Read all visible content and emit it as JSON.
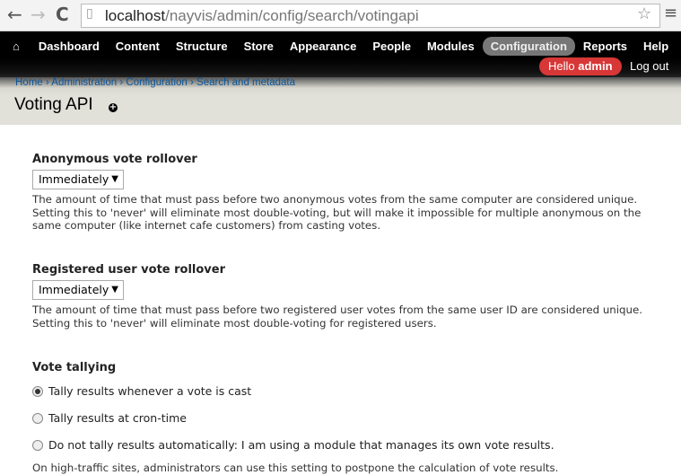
{
  "browser": {
    "url_host": "localhost",
    "url_path": "/nayvis/admin/config/search/votingapi"
  },
  "toolbar": {
    "items": [
      "Dashboard",
      "Content",
      "Structure",
      "Store",
      "Appearance",
      "People",
      "Modules",
      "Configuration",
      "Reports",
      "Help"
    ],
    "hello": "Hello",
    "user": "admin",
    "logout": "Log out"
  },
  "breadcrumb": [
    "Home",
    "Administration",
    "Configuration",
    "Search and metadata"
  ],
  "page_title": "Voting API",
  "anon": {
    "label": "Anonymous vote rollover",
    "value": "Immediately",
    "desc": "The amount of time that must pass before two anonymous votes from the same computer are considered unique. Setting this to 'never' will eliminate most double-voting, but will make it impossible for multiple anonymous on the same computer (like internet cafe customers) from casting votes."
  },
  "reg": {
    "label": "Registered user vote rollover",
    "value": "Immediately",
    "desc": "The amount of time that must pass before two registered user votes from the same user ID are considered unique. Setting this to 'never' will eliminate most double-voting for registered users."
  },
  "tally": {
    "label": "Vote tallying",
    "options": [
      "Tally results whenever a vote is cast",
      "Tally results at cron-time",
      "Do not tally results automatically: I am using a module that manages its own vote results."
    ],
    "desc": "On high-traffic sites, administrators can use this setting to postpone the calculation of vote results."
  }
}
